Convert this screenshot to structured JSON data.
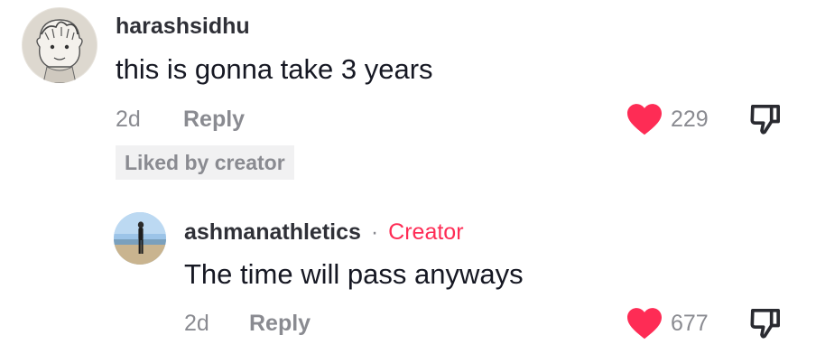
{
  "comments": [
    {
      "username": "harashsidhu",
      "text": "this is gonna take 3 years",
      "age": "2d",
      "reply_label": "Reply",
      "badge": "Liked by creator",
      "likes": "229",
      "liked": true
    },
    {
      "username": "ashmanathletics",
      "separator": "·",
      "role_tag": "Creator",
      "text": "The time will pass anyways",
      "age": "2d",
      "reply_label": "Reply",
      "likes": "677",
      "liked": true
    }
  ],
  "icons": {
    "like": "heart-icon",
    "dislike": "thumbs-down-icon"
  },
  "colors": {
    "heart": "#fe2c55",
    "creator": "#fe2c55",
    "meta": "#8a8b91"
  }
}
